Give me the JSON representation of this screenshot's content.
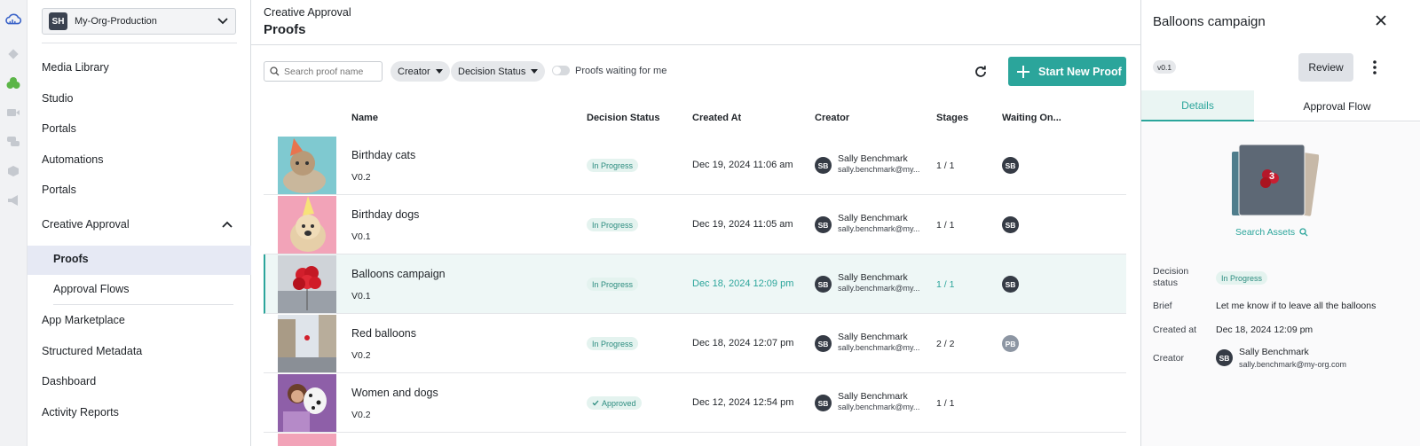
{
  "sidebar": {
    "org": {
      "initials": "SH",
      "name": "My-Org-Production"
    },
    "items": [
      {
        "label": "Media Library"
      },
      {
        "label": "Studio"
      },
      {
        "label": "Portals"
      },
      {
        "label": "Automations"
      },
      {
        "label": "Portals"
      },
      {
        "label": "Creative Approval"
      },
      {
        "label": "Proofs"
      },
      {
        "label": "Approval Flows"
      },
      {
        "label": "App Marketplace"
      },
      {
        "label": "Structured Metadata"
      },
      {
        "label": "Dashboard"
      },
      {
        "label": "Activity Reports"
      }
    ]
  },
  "header": {
    "breadcrumb": "Creative Approval",
    "title": "Proofs"
  },
  "toolbar": {
    "search_placeholder": "Search proof name",
    "creator_filter": "Creator",
    "status_filter": "Decision Status",
    "toggle_label": "Proofs waiting for me",
    "new_proof": "Start New Proof"
  },
  "table": {
    "columns": [
      "Name",
      "Decision Status",
      "Created At",
      "Creator",
      "Stages",
      "Waiting On..."
    ],
    "rows": [
      {
        "name": "Birthday cats",
        "version": "V0.2",
        "status": "In Progress",
        "created": "Dec 19, 2024 11:06 am",
        "creator_initials": "SB",
        "creator_name": "Sally Benchmark",
        "creator_email": "sally.benchmark@my...",
        "stages": "1 / 1",
        "waiting": "SB"
      },
      {
        "name": "Birthday dogs",
        "version": "V0.1",
        "status": "In Progress",
        "created": "Dec 19, 2024 11:05 am",
        "creator_initials": "SB",
        "creator_name": "Sally Benchmark",
        "creator_email": "sally.benchmark@my...",
        "stages": "1 / 1",
        "waiting": "SB"
      },
      {
        "name": "Balloons campaign",
        "version": "V0.1",
        "status": "In Progress",
        "created": "Dec 18, 2024 12:09 pm",
        "creator_initials": "SB",
        "creator_name": "Sally Benchmark",
        "creator_email": "sally.benchmark@my...",
        "stages": "1 / 1",
        "waiting": "SB"
      },
      {
        "name": "Red balloons",
        "version": "V0.2",
        "status": "In Progress",
        "created": "Dec 18, 2024 12:07 pm",
        "creator_initials": "SB",
        "creator_name": "Sally Benchmark",
        "creator_email": "sally.benchmark@my...",
        "stages": "2 / 2",
        "waiting": "PB"
      },
      {
        "name": "Women and dogs",
        "version": "V0.2",
        "status": "Approved",
        "created": "Dec 12, 2024 12:54 pm",
        "creator_initials": "SB",
        "creator_name": "Sally Benchmark",
        "creator_email": "sally.benchmark@my...",
        "stages": "1 / 1",
        "waiting": ""
      }
    ]
  },
  "panel": {
    "title": "Balloons campaign",
    "version": "v0.1",
    "review": "Review",
    "tabs": [
      "Details",
      "Approval Flow"
    ],
    "asset_count": "3",
    "search_assets": "Search Assets",
    "decision_label": "Decision status",
    "decision_value": "In Progress",
    "brief_label": "Brief",
    "brief_value": "Let me know if to leave all the balloons",
    "created_label": "Created at",
    "created_value": "Dec 18, 2024 12:09 pm",
    "creator_label": "Creator",
    "creator_initials": "SB",
    "creator_name": "Sally Benchmark",
    "creator_email": "sally.benchmark@my-org.com"
  },
  "colors": {
    "accent": "#2ba59b",
    "badge_bg": "#e4f3ef",
    "avatar": "#353b45"
  }
}
